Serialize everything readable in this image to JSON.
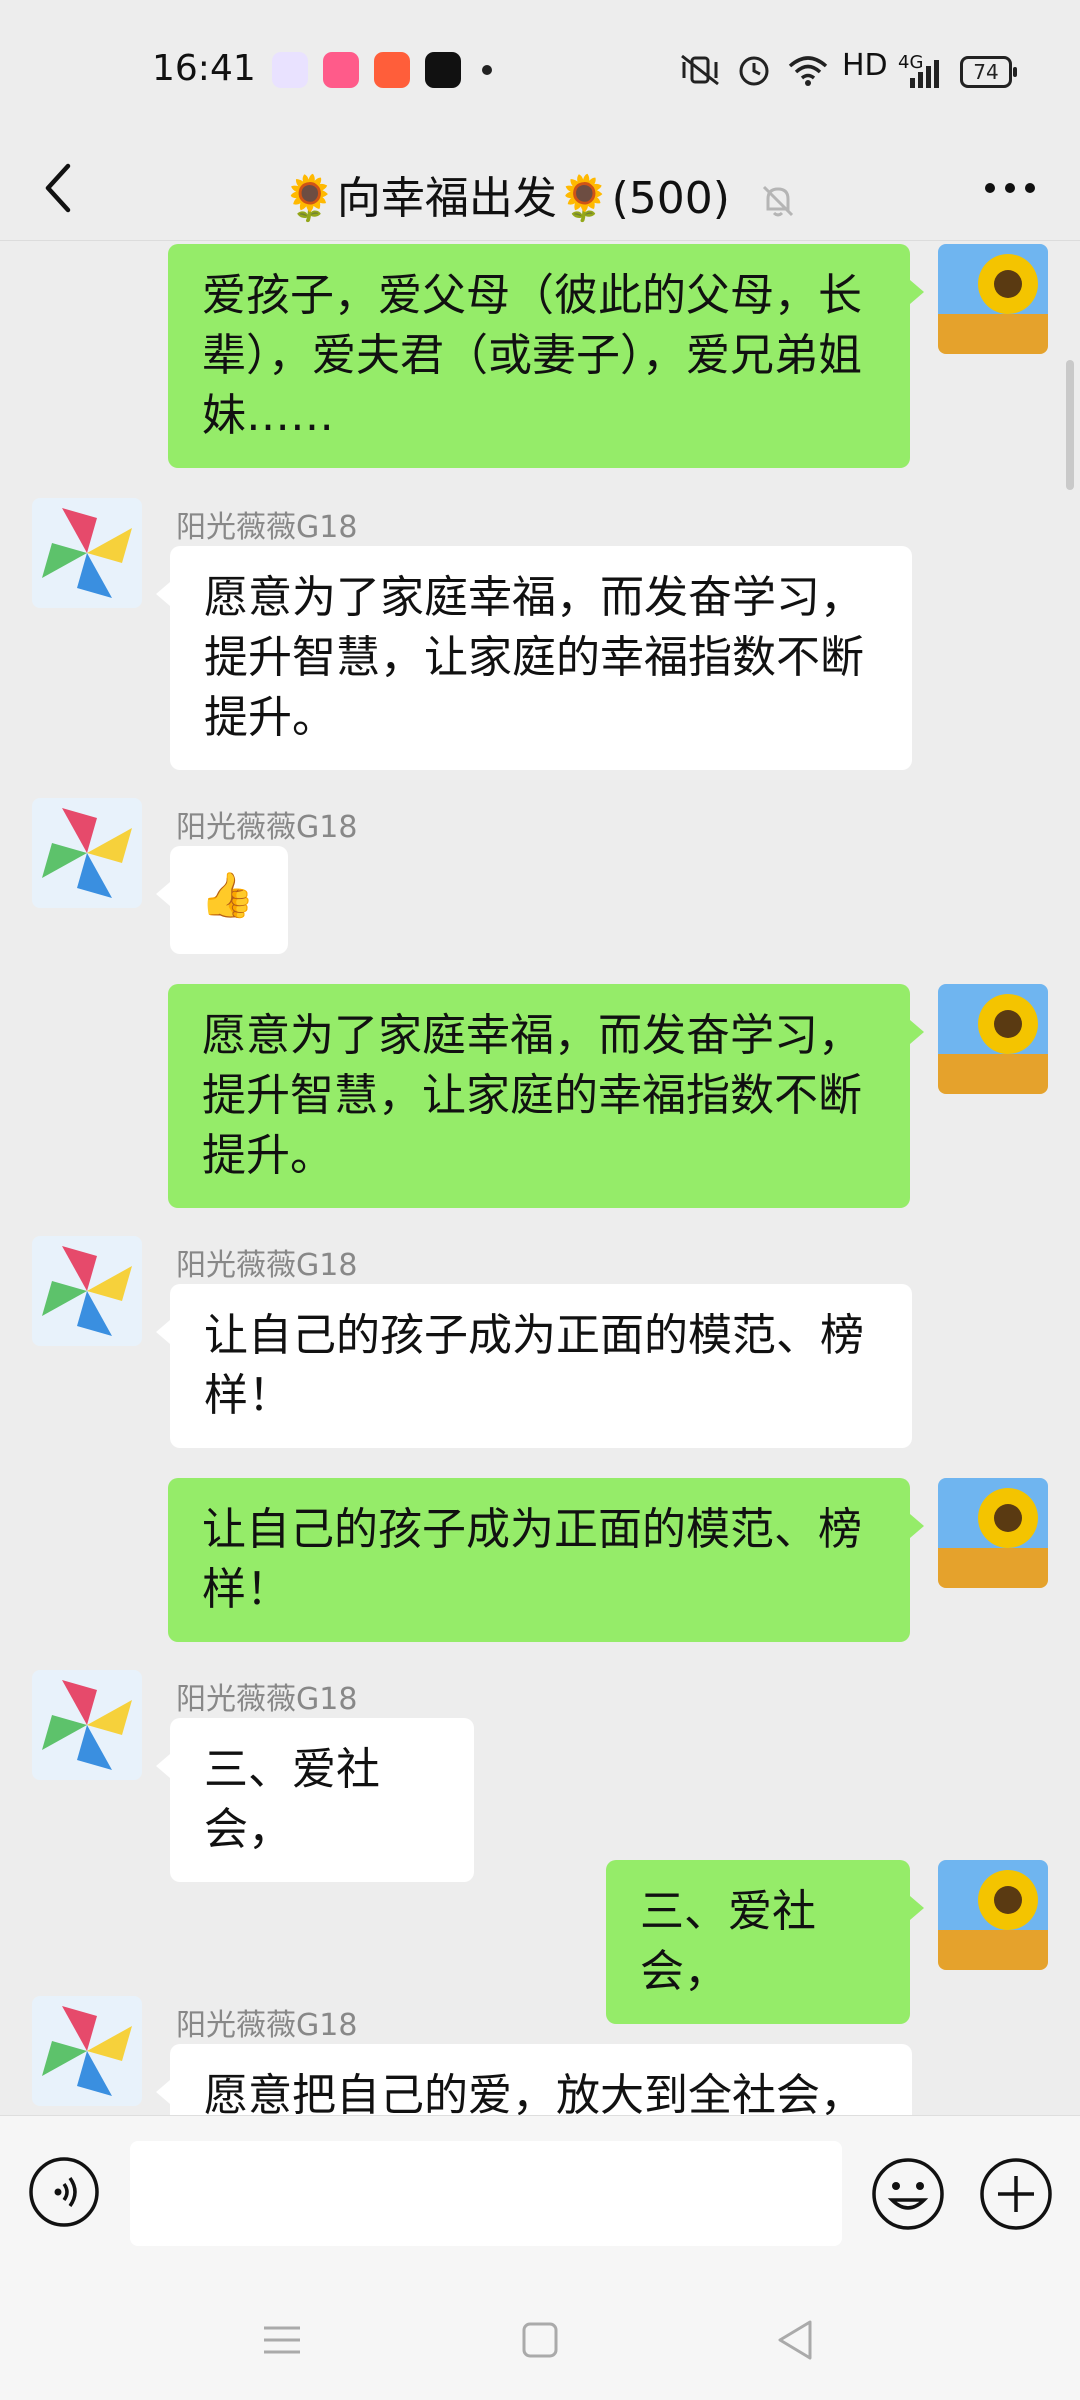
{
  "status_bar": {
    "time": "16:41",
    "network": "HD",
    "signal_label": "4G",
    "battery": "74"
  },
  "header": {
    "title": "🌻向幸福出发🌻(500)"
  },
  "messages": [
    {
      "side": "right",
      "text": "爱孩子，爱父母（彼此的父母，长辈），爱夫君（或妻子），爱兄弟姐妹……"
    },
    {
      "side": "left",
      "sender": "阳光薇薇G18",
      "text": "愿意为了家庭幸福，而发奋学习，提升智慧，让家庭的幸福指数不断提升。"
    },
    {
      "side": "left",
      "sender": "阳光薇薇G18",
      "text": "👍"
    },
    {
      "side": "right",
      "text": "愿意为了家庭幸福，而发奋学习，提升智慧，让家庭的幸福指数不断提升。"
    },
    {
      "side": "left",
      "sender": "阳光薇薇G18",
      "text": "让自己的孩子成为正面的模范、榜样！"
    },
    {
      "side": "right",
      "text": "让自己的孩子成为正面的模范、榜样！"
    },
    {
      "side": "left",
      "sender": "阳光薇薇G18",
      "text": "三、爱社会，"
    },
    {
      "side": "right",
      "text": "三、爱社会，"
    },
    {
      "side": "left",
      "sender": "阳光薇薇G18",
      "text": "愿意把自己的爱，放大到全社会，"
    }
  ],
  "icons": {
    "back": "chevron-left-icon",
    "mute": "bell-mute-icon",
    "more": "more-dots-icon",
    "voice": "voice-icon",
    "emoji": "emoji-icon",
    "plus": "plus-icon"
  },
  "colors": {
    "background": "#ededed",
    "self_bubble": "#95ec69",
    "other_bubble": "#ffffff"
  }
}
